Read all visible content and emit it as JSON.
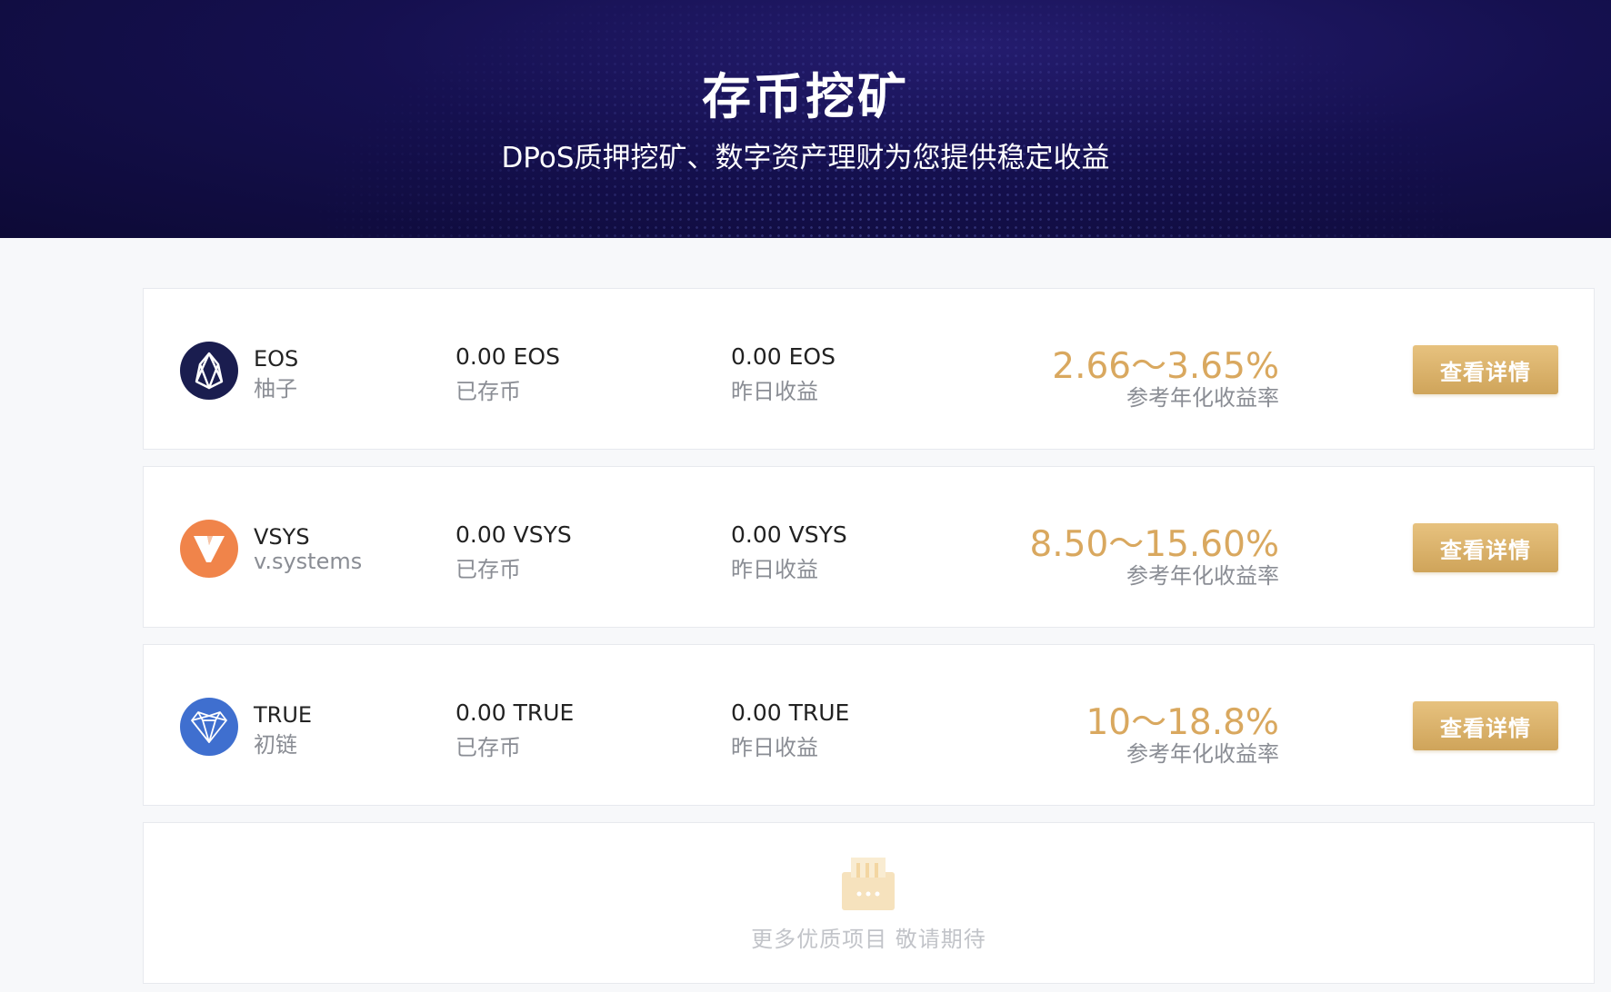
{
  "hero": {
    "title": "存币挖矿",
    "subtitle": "DPoS质押挖矿、数字资产理财为您提供稳定收益"
  },
  "colors": {
    "hero_bg": "#15104f",
    "accent_gold": "#d9a85f",
    "button_gold": "#d8b06a",
    "eos_icon_bg": "#1a1d4f",
    "vsys_icon_bg": "#f0844a",
    "true_icon_bg": "#3f6fcf"
  },
  "products": [
    {
      "icon": "eos-logo-icon",
      "symbol": "EOS",
      "name": "柚子",
      "deposited_value": "0.00 EOS",
      "deposited_label": "已存币",
      "yesterday_value": "0.00 EOS",
      "yesterday_label": "昨日收益",
      "rate": "2.66～3.65%",
      "rate_label": "参考年化收益率",
      "button_label": "查看详情"
    },
    {
      "icon": "vsys-logo-icon",
      "symbol": "VSYS",
      "name": "v.systems",
      "deposited_value": "0.00 VSYS",
      "deposited_label": "已存币",
      "yesterday_value": "0.00 VSYS",
      "yesterday_label": "昨日收益",
      "rate": "8.50～15.60%",
      "rate_label": "参考年化收益率",
      "button_label": "查看详情"
    },
    {
      "icon": "true-logo-icon",
      "symbol": "TRUE",
      "name": "初链",
      "deposited_value": "0.00 TRUE",
      "deposited_label": "已存币",
      "yesterday_value": "0.00 TRUE",
      "yesterday_label": "昨日收益",
      "rate": "10～18.8%",
      "rate_label": "参考年化收益率",
      "button_label": "查看详情"
    }
  ],
  "more": {
    "icon": "factory-icon",
    "text": "更多优质项目 敬请期待"
  }
}
